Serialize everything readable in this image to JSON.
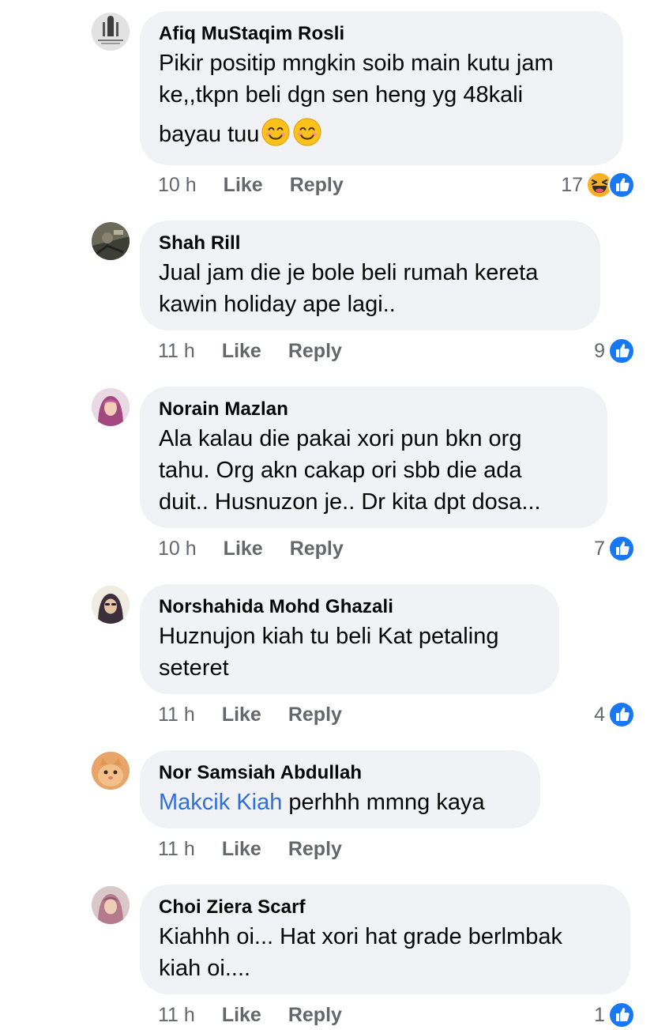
{
  "comments": [
    {
      "author": "Afiq MuStaqim Rosli",
      "text_line1": "Pikir positip mngkin soib main kutu jam",
      "text_line2": "ke,,tkpn beli dgn sen heng yg 48kali",
      "text_line3": "bayau tuu",
      "time": "10 h",
      "like_label": "Like",
      "reply_label": "Reply",
      "reaction_count": "17",
      "reactions": [
        "haha-icon",
        "like-icon"
      ]
    },
    {
      "author": "Shah Rill",
      "text_line1": "Jual jam die je bole beli rumah kereta",
      "text_line2": "kawin holiday ape lagi..",
      "time": "11 h",
      "like_label": "Like",
      "reply_label": "Reply",
      "reaction_count": "9",
      "reactions": [
        "like-icon"
      ]
    },
    {
      "author": "Norain Mazlan",
      "text_line1": "Ala kalau die pakai xori pun bkn org",
      "text_line2": "tahu. Org akn cakap ori sbb die ada",
      "text_line3": "duit.. Husnuzon je.. Dr kita dpt dosa...",
      "time": "10 h",
      "like_label": "Like",
      "reply_label": "Reply",
      "reaction_count": "7",
      "reactions": [
        "like-icon"
      ]
    },
    {
      "author": "Norshahida Mohd Ghazali",
      "text_line1": "Huznujon kiah tu beli Kat petaling",
      "text_line2": "seteret",
      "time": "11 h",
      "like_label": "Like",
      "reply_label": "Reply",
      "reaction_count": "4",
      "reactions": [
        "like-icon"
      ]
    },
    {
      "author": "Nor Samsiah Abdullah",
      "mention": "Makcik Kiah",
      "text_after_mention": " perhhh mmng kaya",
      "time": "11 h",
      "like_label": "Like",
      "reply_label": "Reply"
    },
    {
      "author": "Choi Ziera Scarf",
      "text_line1": "Kiahhh oi... Hat xori hat grade berlmbak",
      "text_line2": "kiah oi....",
      "time": "11 h",
      "like_label": "Like",
      "reply_label": "Reply",
      "reaction_count": "1",
      "reactions": [
        "like-icon"
      ]
    }
  ],
  "colors": {
    "bubble": "#f0f2f5",
    "meta": "#65676b",
    "mention": "#2d6fe0",
    "like_blue": "#1877f2",
    "haha_yellow": "#f7b125"
  }
}
